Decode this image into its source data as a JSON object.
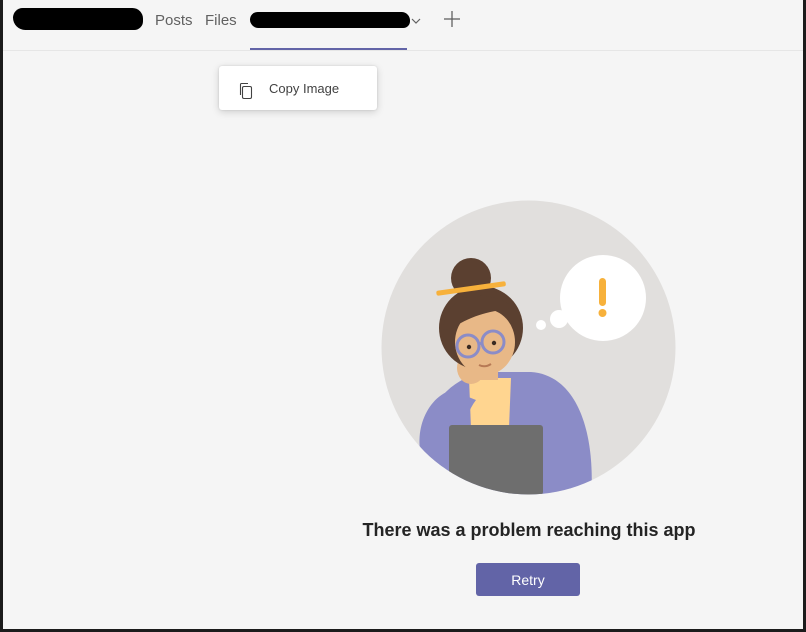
{
  "tabs": {
    "team_name": "",
    "posts": "Posts",
    "files": "Files",
    "app_tab": "",
    "add_tab_icon": "plus-icon",
    "chevron_icon": "chevron-down-icon"
  },
  "context_menu": {
    "copy_image": "Copy Image",
    "copy_icon": "copy-icon"
  },
  "error": {
    "title": "There was a problem reaching this app",
    "retry": "Retry"
  },
  "colors": {
    "accent": "#6264a7",
    "background": "#f5f5f5",
    "alert": "#f7b13b"
  }
}
